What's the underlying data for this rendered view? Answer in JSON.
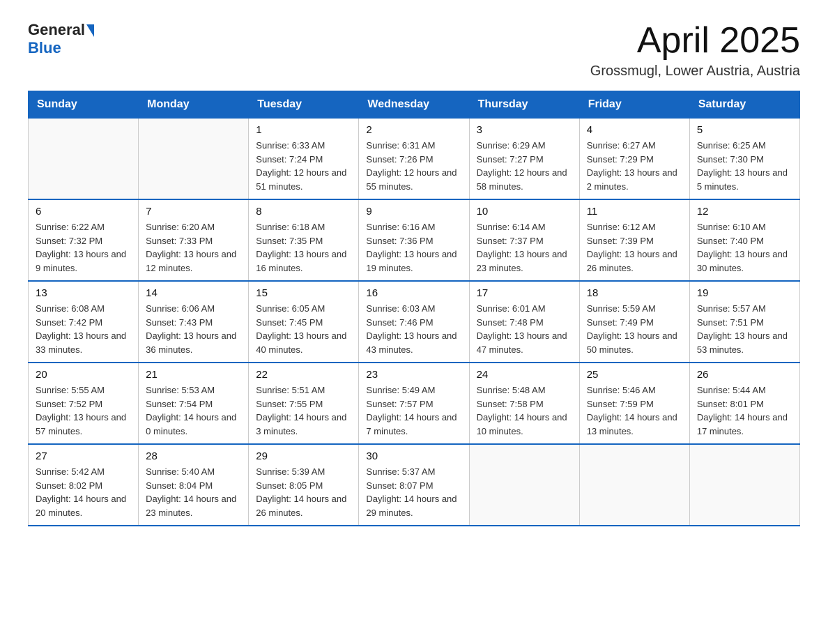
{
  "logo": {
    "text_general": "General",
    "text_blue": "Blue"
  },
  "header": {
    "title": "April 2025",
    "subtitle": "Grossmugl, Lower Austria, Austria"
  },
  "weekdays": [
    "Sunday",
    "Monday",
    "Tuesday",
    "Wednesday",
    "Thursday",
    "Friday",
    "Saturday"
  ],
  "weeks": [
    [
      {
        "day": "",
        "sunrise": "",
        "sunset": "",
        "daylight": ""
      },
      {
        "day": "",
        "sunrise": "",
        "sunset": "",
        "daylight": ""
      },
      {
        "day": "1",
        "sunrise": "Sunrise: 6:33 AM",
        "sunset": "Sunset: 7:24 PM",
        "daylight": "Daylight: 12 hours and 51 minutes."
      },
      {
        "day": "2",
        "sunrise": "Sunrise: 6:31 AM",
        "sunset": "Sunset: 7:26 PM",
        "daylight": "Daylight: 12 hours and 55 minutes."
      },
      {
        "day": "3",
        "sunrise": "Sunrise: 6:29 AM",
        "sunset": "Sunset: 7:27 PM",
        "daylight": "Daylight: 12 hours and 58 minutes."
      },
      {
        "day": "4",
        "sunrise": "Sunrise: 6:27 AM",
        "sunset": "Sunset: 7:29 PM",
        "daylight": "Daylight: 13 hours and 2 minutes."
      },
      {
        "day": "5",
        "sunrise": "Sunrise: 6:25 AM",
        "sunset": "Sunset: 7:30 PM",
        "daylight": "Daylight: 13 hours and 5 minutes."
      }
    ],
    [
      {
        "day": "6",
        "sunrise": "Sunrise: 6:22 AM",
        "sunset": "Sunset: 7:32 PM",
        "daylight": "Daylight: 13 hours and 9 minutes."
      },
      {
        "day": "7",
        "sunrise": "Sunrise: 6:20 AM",
        "sunset": "Sunset: 7:33 PM",
        "daylight": "Daylight: 13 hours and 12 minutes."
      },
      {
        "day": "8",
        "sunrise": "Sunrise: 6:18 AM",
        "sunset": "Sunset: 7:35 PM",
        "daylight": "Daylight: 13 hours and 16 minutes."
      },
      {
        "day": "9",
        "sunrise": "Sunrise: 6:16 AM",
        "sunset": "Sunset: 7:36 PM",
        "daylight": "Daylight: 13 hours and 19 minutes."
      },
      {
        "day": "10",
        "sunrise": "Sunrise: 6:14 AM",
        "sunset": "Sunset: 7:37 PM",
        "daylight": "Daylight: 13 hours and 23 minutes."
      },
      {
        "day": "11",
        "sunrise": "Sunrise: 6:12 AM",
        "sunset": "Sunset: 7:39 PM",
        "daylight": "Daylight: 13 hours and 26 minutes."
      },
      {
        "day": "12",
        "sunrise": "Sunrise: 6:10 AM",
        "sunset": "Sunset: 7:40 PM",
        "daylight": "Daylight: 13 hours and 30 minutes."
      }
    ],
    [
      {
        "day": "13",
        "sunrise": "Sunrise: 6:08 AM",
        "sunset": "Sunset: 7:42 PM",
        "daylight": "Daylight: 13 hours and 33 minutes."
      },
      {
        "day": "14",
        "sunrise": "Sunrise: 6:06 AM",
        "sunset": "Sunset: 7:43 PM",
        "daylight": "Daylight: 13 hours and 36 minutes."
      },
      {
        "day": "15",
        "sunrise": "Sunrise: 6:05 AM",
        "sunset": "Sunset: 7:45 PM",
        "daylight": "Daylight: 13 hours and 40 minutes."
      },
      {
        "day": "16",
        "sunrise": "Sunrise: 6:03 AM",
        "sunset": "Sunset: 7:46 PM",
        "daylight": "Daylight: 13 hours and 43 minutes."
      },
      {
        "day": "17",
        "sunrise": "Sunrise: 6:01 AM",
        "sunset": "Sunset: 7:48 PM",
        "daylight": "Daylight: 13 hours and 47 minutes."
      },
      {
        "day": "18",
        "sunrise": "Sunrise: 5:59 AM",
        "sunset": "Sunset: 7:49 PM",
        "daylight": "Daylight: 13 hours and 50 minutes."
      },
      {
        "day": "19",
        "sunrise": "Sunrise: 5:57 AM",
        "sunset": "Sunset: 7:51 PM",
        "daylight": "Daylight: 13 hours and 53 minutes."
      }
    ],
    [
      {
        "day": "20",
        "sunrise": "Sunrise: 5:55 AM",
        "sunset": "Sunset: 7:52 PM",
        "daylight": "Daylight: 13 hours and 57 minutes."
      },
      {
        "day": "21",
        "sunrise": "Sunrise: 5:53 AM",
        "sunset": "Sunset: 7:54 PM",
        "daylight": "Daylight: 14 hours and 0 minutes."
      },
      {
        "day": "22",
        "sunrise": "Sunrise: 5:51 AM",
        "sunset": "Sunset: 7:55 PM",
        "daylight": "Daylight: 14 hours and 3 minutes."
      },
      {
        "day": "23",
        "sunrise": "Sunrise: 5:49 AM",
        "sunset": "Sunset: 7:57 PM",
        "daylight": "Daylight: 14 hours and 7 minutes."
      },
      {
        "day": "24",
        "sunrise": "Sunrise: 5:48 AM",
        "sunset": "Sunset: 7:58 PM",
        "daylight": "Daylight: 14 hours and 10 minutes."
      },
      {
        "day": "25",
        "sunrise": "Sunrise: 5:46 AM",
        "sunset": "Sunset: 7:59 PM",
        "daylight": "Daylight: 14 hours and 13 minutes."
      },
      {
        "day": "26",
        "sunrise": "Sunrise: 5:44 AM",
        "sunset": "Sunset: 8:01 PM",
        "daylight": "Daylight: 14 hours and 17 minutes."
      }
    ],
    [
      {
        "day": "27",
        "sunrise": "Sunrise: 5:42 AM",
        "sunset": "Sunset: 8:02 PM",
        "daylight": "Daylight: 14 hours and 20 minutes."
      },
      {
        "day": "28",
        "sunrise": "Sunrise: 5:40 AM",
        "sunset": "Sunset: 8:04 PM",
        "daylight": "Daylight: 14 hours and 23 minutes."
      },
      {
        "day": "29",
        "sunrise": "Sunrise: 5:39 AM",
        "sunset": "Sunset: 8:05 PM",
        "daylight": "Daylight: 14 hours and 26 minutes."
      },
      {
        "day": "30",
        "sunrise": "Sunrise: 5:37 AM",
        "sunset": "Sunset: 8:07 PM",
        "daylight": "Daylight: 14 hours and 29 minutes."
      },
      {
        "day": "",
        "sunrise": "",
        "sunset": "",
        "daylight": ""
      },
      {
        "day": "",
        "sunrise": "",
        "sunset": "",
        "daylight": ""
      },
      {
        "day": "",
        "sunrise": "",
        "sunset": "",
        "daylight": ""
      }
    ]
  ]
}
